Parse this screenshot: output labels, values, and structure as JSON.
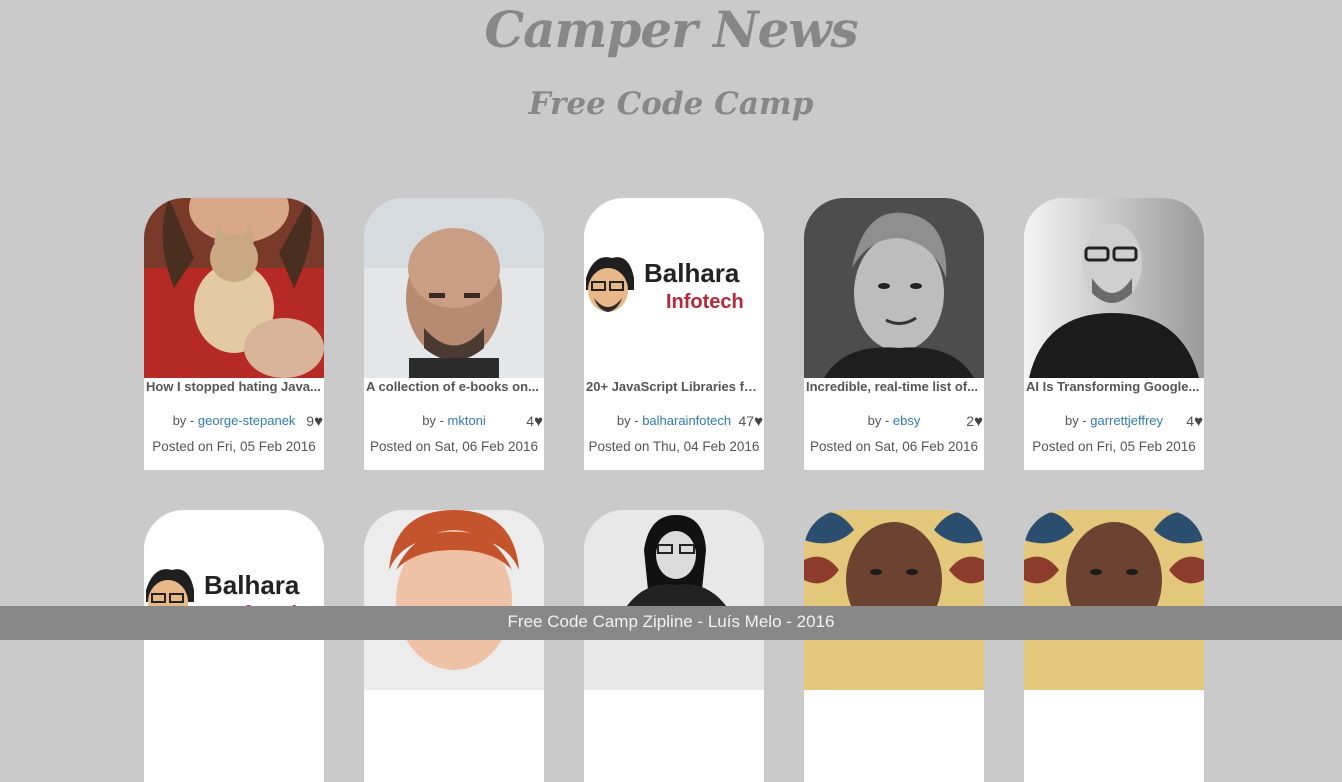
{
  "header": {
    "title": "Camper News",
    "subtitle": "Free Code Camp"
  },
  "posts": [
    {
      "headline": "How I stopped hating Java...",
      "by_prefix": "by - ",
      "author": "george-stepanek",
      "likes": "9",
      "posted": "Posted on Fri, 05 Feb 2016",
      "avatar": "photo-man-with-cat"
    },
    {
      "headline": "A collection of e-books on...",
      "by_prefix": "by - ",
      "author": "mktoni",
      "likes": "4",
      "posted": "Posted on Sat, 06 Feb 2016",
      "avatar": "photo-bald-man-selfie"
    },
    {
      "headline": "20+ JavaScript Libraries fo...",
      "by_prefix": "by - ",
      "author": "balharainfotech",
      "likes": "47",
      "posted": "Posted on Thu, 04 Feb 2016",
      "avatar": "balhara-infotech-logo"
    },
    {
      "headline": "Incredible, real-time list of...",
      "by_prefix": "by - ",
      "author": "ebsy",
      "likes": "2",
      "posted": "Posted on Sat, 06 Feb 2016",
      "avatar": "photo-man-bw"
    },
    {
      "headline": "AI Is Transforming Google...",
      "by_prefix": "by - ",
      "author": "garrettjeffrey",
      "likes": "4",
      "posted": "Posted on Fri, 05 Feb 2016",
      "avatar": "photo-bald-man-glasses-bw"
    },
    {
      "avatar": "balhara-infotech-logo"
    },
    {
      "avatar": "photo-red-haired-man"
    },
    {
      "avatar": "photo-woman-glasses-bw"
    },
    {
      "avatar": "photo-man-patterned-bg"
    },
    {
      "avatar": "photo-man-patterned-bg"
    }
  ],
  "logo_text": {
    "line1": "Balhara",
    "line2": "Infotech"
  },
  "footer": {
    "text": "Free Code Camp Zipline - Luís Melo - 2016"
  },
  "colors": {
    "background": "#cacaca",
    "title": "#878787",
    "link": "#337ab7",
    "footer_bg": "#888888"
  }
}
